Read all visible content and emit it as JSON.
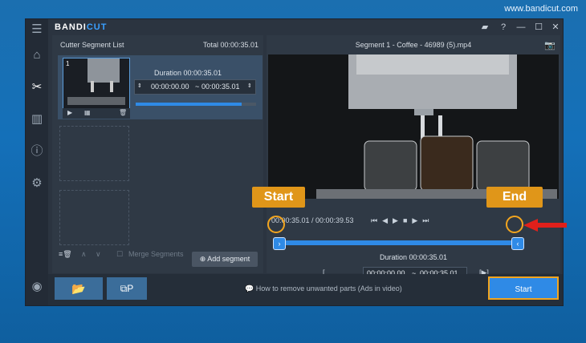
{
  "watermark": "www.bandicut.com",
  "app": {
    "logo_bandi": "BANDI",
    "logo_cut": "CUT"
  },
  "segments": {
    "title": "Cutter Segment List",
    "total": "Total 00:00:35.01",
    "item": {
      "number": "1",
      "duration": "Duration 00:00:35.01",
      "start": "00:00:00.00",
      "sep": "~",
      "end": "00:00:35.01",
      "progress": 0.88
    },
    "merge_label": "Merge Segments",
    "add_button": "Add segment"
  },
  "player": {
    "title": "Segment 1 - Coffee - 46989 (5).mp4",
    "time_current": "00:00:35.01",
    "time_total": "/ 00:00:39.53",
    "duration": "Duration 00:00:35.01",
    "start": "00:00:00.00",
    "sep": "~",
    "end": "00:00:35.01"
  },
  "bottom": {
    "ads_text": "How to remove unwanted parts (Ads in video)",
    "start_button": "Start"
  },
  "annotations": {
    "start": "Start",
    "end": "End"
  },
  "colors": {
    "accent": "#2f8ae6",
    "highlight": "#f2a51f",
    "arrow": "#e0201b"
  }
}
